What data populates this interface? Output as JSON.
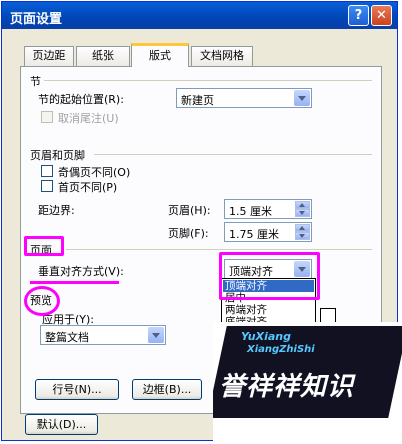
{
  "window": {
    "title": "页面设置",
    "help_label": "?",
    "close_label": "✕"
  },
  "tabs": [
    {
      "label": "页边距",
      "active": false
    },
    {
      "label": "纸张",
      "active": false
    },
    {
      "label": "版式",
      "active": true
    },
    {
      "label": "文档网格",
      "active": false
    }
  ],
  "section": {
    "label": "节",
    "start_label": "节的起始位置(R):",
    "start_value": "新建页",
    "suppress_endnotes_label": "取消尾注(U)"
  },
  "headers_footers": {
    "label": "页眉和页脚",
    "odd_even_label": "奇偶页不同(O)",
    "first_page_label": "首页不同(P)",
    "from_edge_label": "距边界:",
    "header_label": "页眉(H):",
    "header_value": "1.5 厘米",
    "footer_label": "页脚(F):",
    "footer_value": "1.75 厘米"
  },
  "page": {
    "label": "页面",
    "vertical_align_label": "垂直对齐方式(V):",
    "vertical_align_value": "顶端对齐",
    "options": [
      "顶端对齐",
      "居中",
      "两端对齐",
      "底端对齐"
    ],
    "selected_index": 0
  },
  "preview": {
    "label": "预览",
    "apply_to_label": "应用于(Y):",
    "apply_to_value": "整篇文档"
  },
  "buttons": {
    "line_numbers": "行号(N)...",
    "borders": "边框(B)...",
    "default": "默认(D)..."
  },
  "watermark": {
    "line1": "YuXiang",
    "line2": "XiangZhiShi",
    "text": "誉祥祥知识"
  },
  "colors": {
    "highlight": "#ff00ff",
    "titlebar": "#0a5fd8",
    "selection": "#316ac5"
  }
}
